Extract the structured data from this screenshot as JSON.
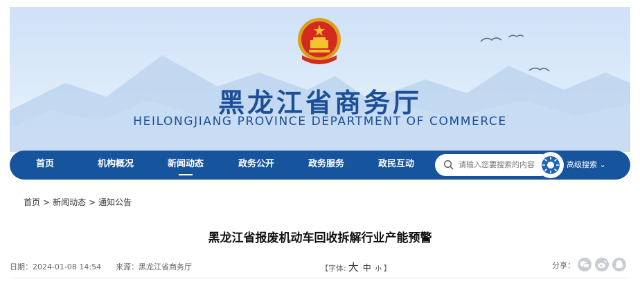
{
  "header": {
    "title_cn": "黑龙江省商务厅",
    "title_en": "HEILONGJIANG PROVINCE DEPARTMENT OF COMMERCE"
  },
  "nav": {
    "items": [
      "首页",
      "机构概况",
      "新闻动态",
      "政务公开",
      "政务服务",
      "政民互动"
    ],
    "active": "新闻动态",
    "search_placeholder": "请输入您要搜索的内容",
    "advanced_search": "高级搜索"
  },
  "breadcrumb": {
    "items": [
      "首页",
      "新闻动态",
      "通知公告"
    ],
    "separator": ">"
  },
  "article": {
    "title": "黑龙江省报废机动车回收拆解行业产能预警",
    "date_label": "日期：",
    "date": "2024-01-08 14:54",
    "source_label": "来源：",
    "source": "黑龙江省商务厅",
    "font_prefix": "【字体:",
    "font_large": "大",
    "font_medium": "中",
    "font_small": "小",
    "font_suffix": "】",
    "share_label": "分享："
  },
  "colors": {
    "nav_bg": "#17549e",
    "title_blue": "#1c4f98"
  },
  "icons": {
    "search": "search-icon",
    "share": [
      "wechat-icon",
      "weibo-icon",
      "qq-icon"
    ]
  }
}
